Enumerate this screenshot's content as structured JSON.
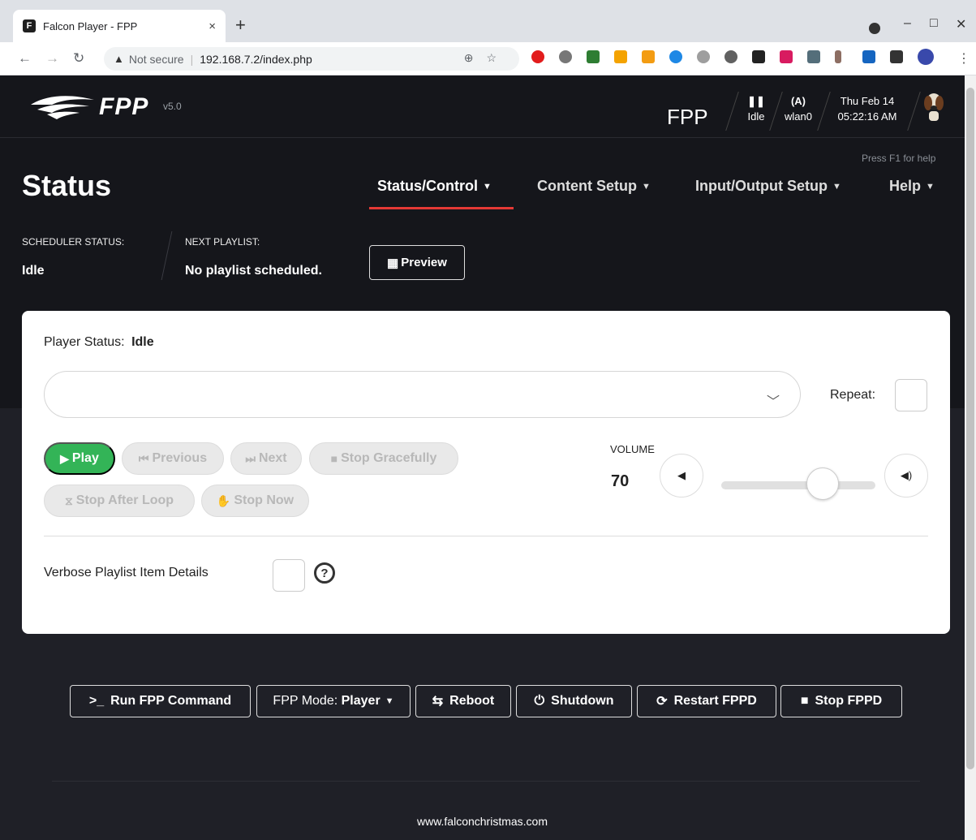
{
  "browser": {
    "tab_title": "Falcon Player - FPP",
    "new_tab": "+",
    "close_tab": "×",
    "minimize": "–",
    "maximize": "□",
    "close": "✕",
    "security_label": "Not secure",
    "url": "192.168.7.2/index.php"
  },
  "header": {
    "logo_text": "FPP",
    "version": "v5.0",
    "host_name": "FPP",
    "player_state_icon": "❚❚",
    "player_state": "Idle",
    "wifi_icon": "(A)",
    "wifi_iface": "wlan0",
    "date": "Thu Feb 14",
    "time": "05:22:16 AM"
  },
  "help_hint": "Press F1 for help",
  "page_title": "Status",
  "nav": {
    "items": [
      {
        "label": "Status/Control"
      },
      {
        "label": "Content Setup"
      },
      {
        "label": "Input/Output Setup"
      },
      {
        "label": "Help"
      }
    ],
    "active": "Status/Control"
  },
  "scheduler": {
    "status_label": "SCHEDULER STATUS:",
    "status_value": "Idle",
    "next_label": "NEXT PLAYLIST:",
    "next_value": "No playlist scheduled.",
    "preview_label": "Preview"
  },
  "player": {
    "status_label": "Player Status:",
    "status_value": "Idle",
    "playlist_value": "",
    "repeat_label": "Repeat:",
    "buttons": {
      "play": "Play",
      "previous": "Previous",
      "next": "Next",
      "stop_gracefully": "Stop Gracefully",
      "stop_after_loop": "Stop After Loop",
      "stop_now": "Stop Now"
    },
    "volume_label": "VOLUME",
    "volume_value": "70",
    "verbose_label": "Verbose Playlist Item Details",
    "help_icon": "?"
  },
  "footer": {
    "run_command": "Run FPP Command",
    "mode_prefix": "FPP Mode:",
    "mode_value": "Player",
    "reboot": "Reboot",
    "shutdown": "Shutdown",
    "restart": "Restart FPPD",
    "stop": "Stop FPPD",
    "site": "www.falconchristmas.com"
  },
  "colors": {
    "accent_red": "#e53935",
    "play_green": "#33b457",
    "header_bg": "#15161b",
    "page_bg": "#1f2027"
  }
}
